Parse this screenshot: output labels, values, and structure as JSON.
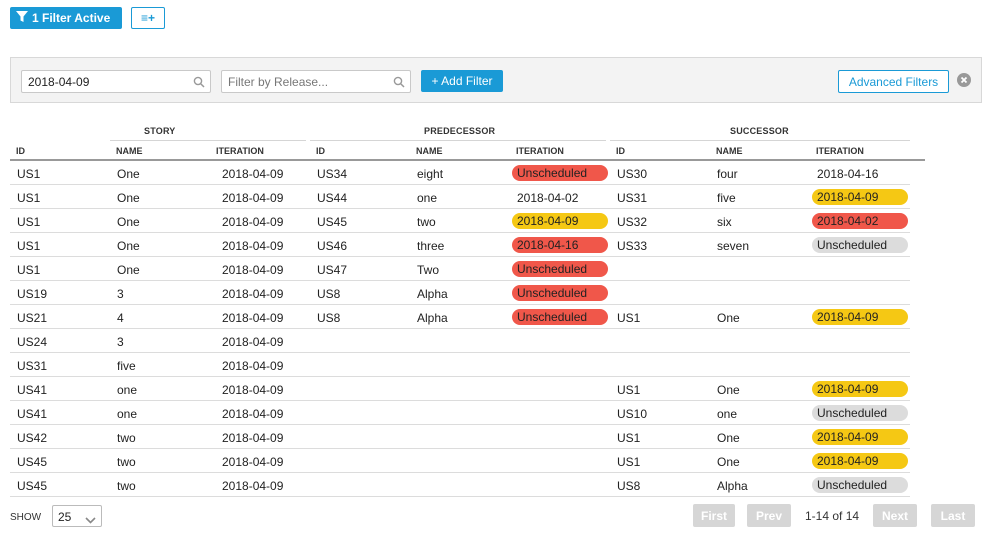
{
  "toolbar": {
    "filter_active_label": "1 Filter Active",
    "columns_button_glyph": "≡+"
  },
  "filters": {
    "date_value": "2018-04-09",
    "release_placeholder": "Filter by Release...",
    "add_filter_label": "+ Add Filter",
    "advanced_filters_label": "Advanced Filters"
  },
  "table": {
    "groups": [
      "STORY",
      "PREDECESSOR",
      "SUCCESSOR"
    ],
    "columns": [
      "ID",
      "NAME",
      "ITERATION",
      "ID",
      "NAME",
      "ITERATION",
      "ID",
      "NAME",
      "ITERATION"
    ],
    "rows": [
      {
        "s_id": "US1",
        "s_name": "One",
        "s_iter": "2018-04-09",
        "p_id": "US34",
        "p_name": "eight",
        "p_iter": "Unscheduled",
        "p_status": "red",
        "c_id": "US30",
        "c_name": "four",
        "c_iter": "2018-04-16",
        "c_status": "none"
      },
      {
        "s_id": "US1",
        "s_name": "One",
        "s_iter": "2018-04-09",
        "p_id": "US44",
        "p_name": "one",
        "p_iter": "2018-04-02",
        "p_status": "none",
        "c_id": "US31",
        "c_name": "five",
        "c_iter": "2018-04-09",
        "c_status": "yellow"
      },
      {
        "s_id": "US1",
        "s_name": "One",
        "s_iter": "2018-04-09",
        "p_id": "US45",
        "p_name": "two",
        "p_iter": "2018-04-09",
        "p_status": "yellow",
        "c_id": "US32",
        "c_name": "six",
        "c_iter": "2018-04-02",
        "c_status": "red"
      },
      {
        "s_id": "US1",
        "s_name": "One",
        "s_iter": "2018-04-09",
        "p_id": "US46",
        "p_name": "three",
        "p_iter": "2018-04-16",
        "p_status": "red",
        "c_id": "US33",
        "c_name": "seven",
        "c_iter": "Unscheduled",
        "c_status": "gray"
      },
      {
        "s_id": "US1",
        "s_name": "One",
        "s_iter": "2018-04-09",
        "p_id": "US47",
        "p_name": "Two",
        "p_iter": "Unscheduled",
        "p_status": "red",
        "c_id": "",
        "c_name": "",
        "c_iter": "",
        "c_status": "none"
      },
      {
        "s_id": "US19",
        "s_name": "3",
        "s_iter": "2018-04-09",
        "p_id": "US8",
        "p_name": "Alpha",
        "p_iter": "Unscheduled",
        "p_status": "red",
        "c_id": "",
        "c_name": "",
        "c_iter": "",
        "c_status": "none"
      },
      {
        "s_id": "US21",
        "s_name": "4",
        "s_iter": "2018-04-09",
        "p_id": "US8",
        "p_name": "Alpha",
        "p_iter": "Unscheduled",
        "p_status": "red",
        "c_id": "US1",
        "c_name": "One",
        "c_iter": "2018-04-09",
        "c_status": "yellow"
      },
      {
        "s_id": "US24",
        "s_name": "3",
        "s_iter": "2018-04-09",
        "p_id": "",
        "p_name": "",
        "p_iter": "",
        "p_status": "none",
        "c_id": "",
        "c_name": "",
        "c_iter": "",
        "c_status": "none"
      },
      {
        "s_id": "US31",
        "s_name": "five",
        "s_iter": "2018-04-09",
        "p_id": "",
        "p_name": "",
        "p_iter": "",
        "p_status": "none",
        "c_id": "",
        "c_name": "",
        "c_iter": "",
        "c_status": "none"
      },
      {
        "s_id": "US41",
        "s_name": "one",
        "s_iter": "2018-04-09",
        "p_id": "",
        "p_name": "",
        "p_iter": "",
        "p_status": "none",
        "c_id": "US1",
        "c_name": "One",
        "c_iter": "2018-04-09",
        "c_status": "yellow"
      },
      {
        "s_id": "US41",
        "s_name": "one",
        "s_iter": "2018-04-09",
        "p_id": "",
        "p_name": "",
        "p_iter": "",
        "p_status": "none",
        "c_id": "US10",
        "c_name": "one",
        "c_iter": "Unscheduled",
        "c_status": "gray"
      },
      {
        "s_id": "US42",
        "s_name": "two",
        "s_iter": "2018-04-09",
        "p_id": "",
        "p_name": "",
        "p_iter": "",
        "p_status": "none",
        "c_id": "US1",
        "c_name": "One",
        "c_iter": "2018-04-09",
        "c_status": "yellow"
      },
      {
        "s_id": "US45",
        "s_name": "two",
        "s_iter": "2018-04-09",
        "p_id": "",
        "p_name": "",
        "p_iter": "",
        "p_status": "none",
        "c_id": "US1",
        "c_name": "One",
        "c_iter": "2018-04-09",
        "c_status": "yellow"
      },
      {
        "s_id": "US45",
        "s_name": "two",
        "s_iter": "2018-04-09",
        "p_id": "",
        "p_name": "",
        "p_iter": "",
        "p_status": "none",
        "c_id": "US8",
        "c_name": "Alpha",
        "c_iter": "Unscheduled",
        "c_status": "gray"
      }
    ]
  },
  "pagination": {
    "show_label": "SHOW",
    "page_size": "25",
    "first_label": "First",
    "prev_label": "Prev",
    "info": "1-14 of 14",
    "next_label": "Next",
    "last_label": "Last"
  },
  "colors": {
    "accent": "#1a9ad6",
    "red": "#f0574a",
    "yellow": "#f5c814",
    "gray": "#dcdcdc"
  },
  "icons": [
    "funnel-icon",
    "columns-add-icon",
    "search-icon",
    "clear-filters-icon",
    "chevron-down-icon"
  ]
}
